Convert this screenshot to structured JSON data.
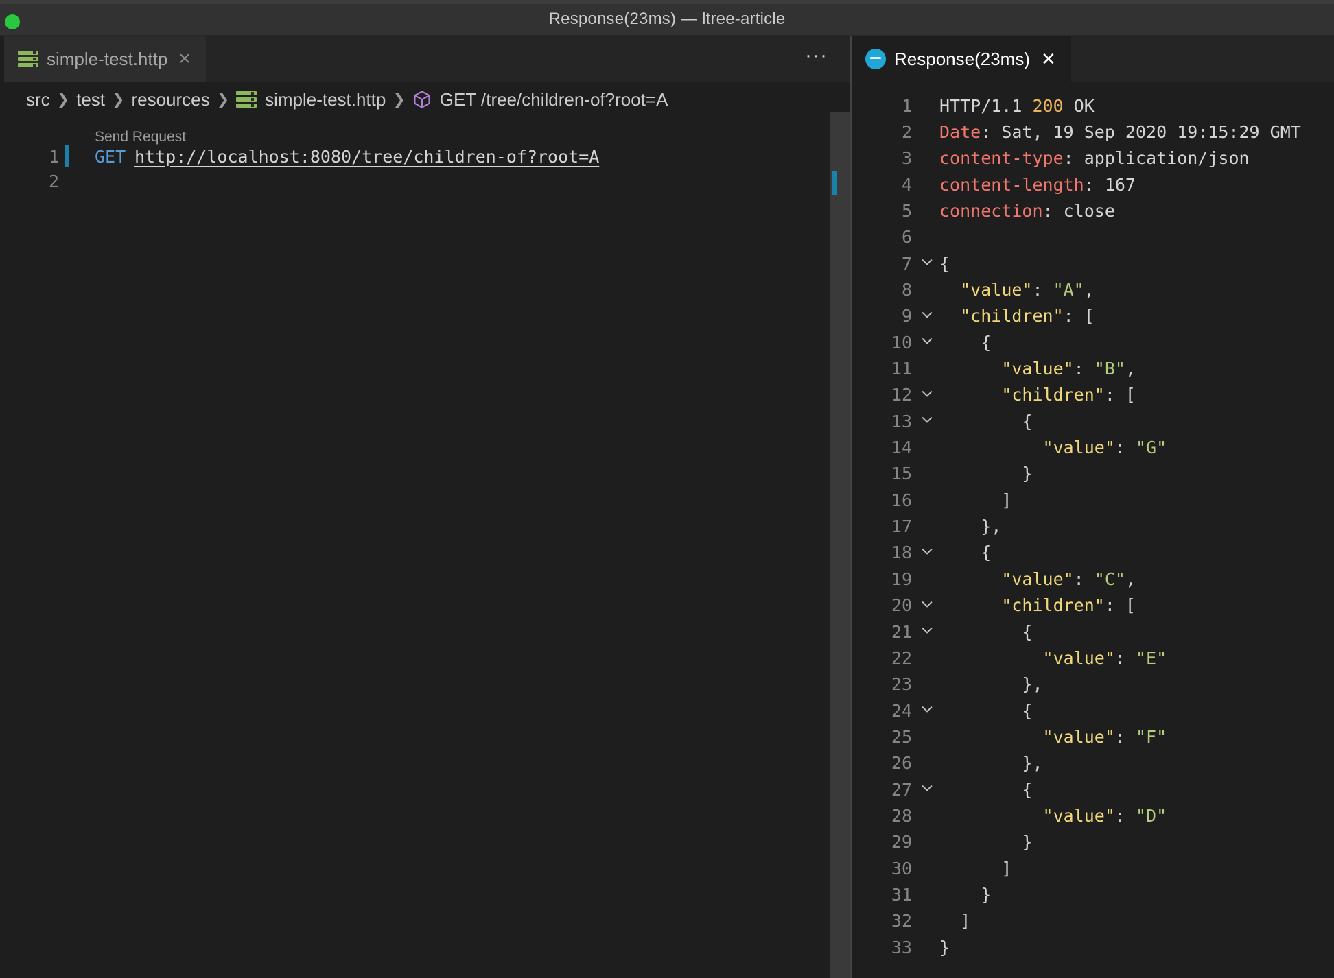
{
  "window": {
    "title": "Response(23ms) — ltree-article"
  },
  "left_pane": {
    "tab": {
      "label": "simple-test.http",
      "close": "×"
    },
    "more_actions": "···",
    "breadcrumb": [
      "src",
      "test",
      "resources",
      "simple-test.http",
      "GET /tree/children-of?root=A"
    ],
    "codelens": "Send Request",
    "lines": [
      {
        "num": "1",
        "method": "GET",
        "url": "http://localhost:8080/tree/children-of?root=A"
      },
      {
        "num": "2"
      }
    ]
  },
  "right_pane": {
    "tab": {
      "label": "Response(23ms)",
      "close": "✕"
    },
    "lines": [
      {
        "num": "1",
        "parts": [
          [
            "plain",
            "HTTP/1.1 "
          ],
          [
            "status",
            "200"
          ],
          [
            "plain",
            " OK"
          ]
        ]
      },
      {
        "num": "2",
        "parts": [
          [
            "header",
            "Date"
          ],
          [
            "plain",
            ": Sat, 19 Sep 2020 19:15:29 GMT"
          ]
        ]
      },
      {
        "num": "3",
        "parts": [
          [
            "header",
            "content-type"
          ],
          [
            "plain",
            ": application/json"
          ]
        ]
      },
      {
        "num": "4",
        "parts": [
          [
            "header",
            "content-length"
          ],
          [
            "plain",
            ": 167"
          ]
        ]
      },
      {
        "num": "5",
        "parts": [
          [
            "header",
            "connection"
          ],
          [
            "plain",
            ": close"
          ]
        ]
      },
      {
        "num": "6",
        "parts": []
      },
      {
        "num": "7",
        "fold": true,
        "parts": [
          [
            "plain",
            "{"
          ]
        ]
      },
      {
        "num": "8",
        "parts": [
          [
            "plain",
            "  "
          ],
          [
            "jkey",
            "\"value\""
          ],
          [
            "plain",
            ": "
          ],
          [
            "jstr",
            "\"A\""
          ],
          [
            "plain",
            ","
          ]
        ]
      },
      {
        "num": "9",
        "fold": true,
        "parts": [
          [
            "plain",
            "  "
          ],
          [
            "jkey",
            "\"children\""
          ],
          [
            "plain",
            ": ["
          ]
        ]
      },
      {
        "num": "10",
        "fold": true,
        "parts": [
          [
            "plain",
            "    {"
          ]
        ]
      },
      {
        "num": "11",
        "parts": [
          [
            "plain",
            "      "
          ],
          [
            "jkey",
            "\"value\""
          ],
          [
            "plain",
            ": "
          ],
          [
            "jstr",
            "\"B\""
          ],
          [
            "plain",
            ","
          ]
        ]
      },
      {
        "num": "12",
        "fold": true,
        "parts": [
          [
            "plain",
            "      "
          ],
          [
            "jkey",
            "\"children\""
          ],
          [
            "plain",
            ": ["
          ]
        ]
      },
      {
        "num": "13",
        "fold": true,
        "parts": [
          [
            "plain",
            "        {"
          ]
        ]
      },
      {
        "num": "14",
        "parts": [
          [
            "plain",
            "          "
          ],
          [
            "jkey",
            "\"value\""
          ],
          [
            "plain",
            ": "
          ],
          [
            "jstr",
            "\"G\""
          ]
        ]
      },
      {
        "num": "15",
        "parts": [
          [
            "plain",
            "        }"
          ]
        ]
      },
      {
        "num": "16",
        "parts": [
          [
            "plain",
            "      ]"
          ]
        ]
      },
      {
        "num": "17",
        "parts": [
          [
            "plain",
            "    },"
          ]
        ]
      },
      {
        "num": "18",
        "fold": true,
        "parts": [
          [
            "plain",
            "    {"
          ]
        ]
      },
      {
        "num": "19",
        "parts": [
          [
            "plain",
            "      "
          ],
          [
            "jkey",
            "\"value\""
          ],
          [
            "plain",
            ": "
          ],
          [
            "jstr",
            "\"C\""
          ],
          [
            "plain",
            ","
          ]
        ]
      },
      {
        "num": "20",
        "fold": true,
        "parts": [
          [
            "plain",
            "      "
          ],
          [
            "jkey",
            "\"children\""
          ],
          [
            "plain",
            ": ["
          ]
        ]
      },
      {
        "num": "21",
        "fold": true,
        "parts": [
          [
            "plain",
            "        {"
          ]
        ]
      },
      {
        "num": "22",
        "parts": [
          [
            "plain",
            "          "
          ],
          [
            "jkey",
            "\"value\""
          ],
          [
            "plain",
            ": "
          ],
          [
            "jstr",
            "\"E\""
          ]
        ]
      },
      {
        "num": "23",
        "parts": [
          [
            "plain",
            "        },"
          ]
        ]
      },
      {
        "num": "24",
        "fold": true,
        "parts": [
          [
            "plain",
            "        {"
          ]
        ]
      },
      {
        "num": "25",
        "parts": [
          [
            "plain",
            "          "
          ],
          [
            "jkey",
            "\"value\""
          ],
          [
            "plain",
            ": "
          ],
          [
            "jstr",
            "\"F\""
          ]
        ]
      },
      {
        "num": "26",
        "parts": [
          [
            "plain",
            "        },"
          ]
        ]
      },
      {
        "num": "27",
        "fold": true,
        "parts": [
          [
            "plain",
            "        {"
          ]
        ]
      },
      {
        "num": "28",
        "parts": [
          [
            "plain",
            "          "
          ],
          [
            "jkey",
            "\"value\""
          ],
          [
            "plain",
            ": "
          ],
          [
            "jstr",
            "\"D\""
          ]
        ]
      },
      {
        "num": "29",
        "parts": [
          [
            "plain",
            "        }"
          ]
        ]
      },
      {
        "num": "30",
        "parts": [
          [
            "plain",
            "      ]"
          ]
        ]
      },
      {
        "num": "31",
        "parts": [
          [
            "plain",
            "    }"
          ]
        ]
      },
      {
        "num": "32",
        "parts": [
          [
            "plain",
            "  ]"
          ]
        ]
      },
      {
        "num": "33",
        "parts": [
          [
            "plain",
            "}"
          ]
        ]
      }
    ]
  },
  "icons": {
    "window_control": "window-zoom-icon",
    "file": "http-file-icon",
    "response": "rest-client-icon",
    "symbol": "request-symbol-icon",
    "fold": "chevron-down-icon"
  },
  "colors": {
    "background": "#1e1e1e",
    "http_method": "#569cd6",
    "header_key": "#f1766d",
    "status_code": "#e9b45b",
    "json_key": "#f0d779",
    "json_string": "#b5cc7c",
    "modified_indicator": "#1b81a8"
  }
}
